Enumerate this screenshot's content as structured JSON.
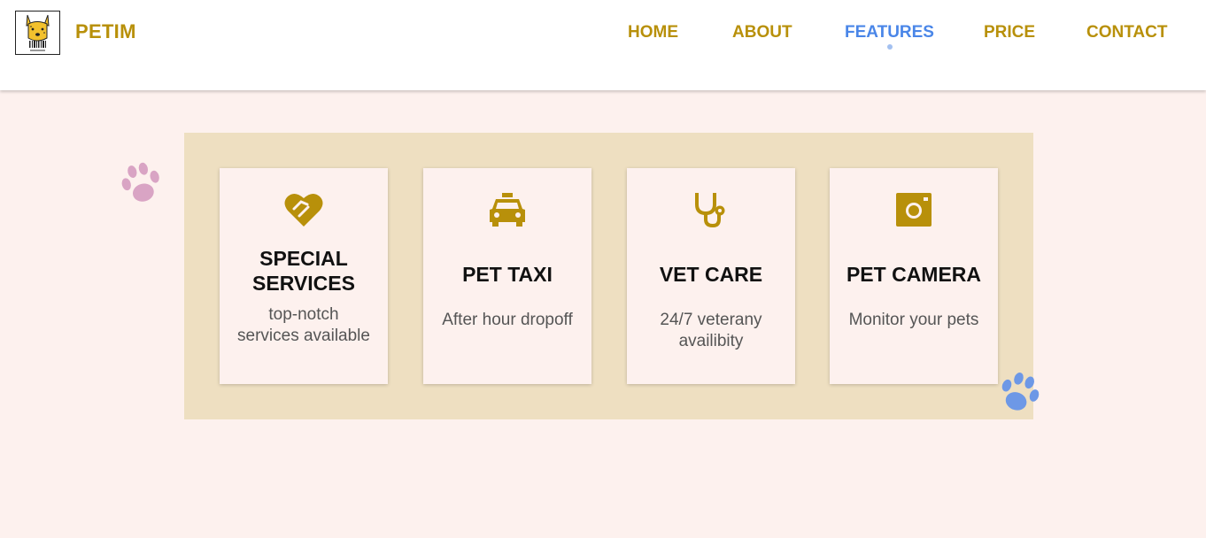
{
  "brand": {
    "name": "PETIM",
    "logo_icon": "dog-logo-icon"
  },
  "nav": {
    "items": [
      {
        "label": "HOME",
        "active": false
      },
      {
        "label": "ABOUT",
        "active": false
      },
      {
        "label": "FEATURES",
        "active": true
      },
      {
        "label": "PRICE",
        "active": false
      },
      {
        "label": "CONTACT",
        "active": false
      }
    ]
  },
  "colors": {
    "accent": "#b8900a",
    "active_nav": "#4a86e8",
    "page_bg": "#fdf1ee",
    "panel_bg": "#eedfc1",
    "paw_pink": "#d9a4c4",
    "paw_blue": "#6d98e6"
  },
  "features": [
    {
      "icon": "heart-handshake-icon",
      "title": "SPECIAL SERVICES",
      "description": "top-notch services available"
    },
    {
      "icon": "taxi-icon",
      "title": "PET TAXI",
      "description": "After hour dropoff"
    },
    {
      "icon": "stethoscope-icon",
      "title": "VET CARE",
      "description": "24/7 veterany availibity"
    },
    {
      "icon": "camera-icon",
      "title": "PET CAMERA",
      "description": "Monitor your pets"
    }
  ]
}
